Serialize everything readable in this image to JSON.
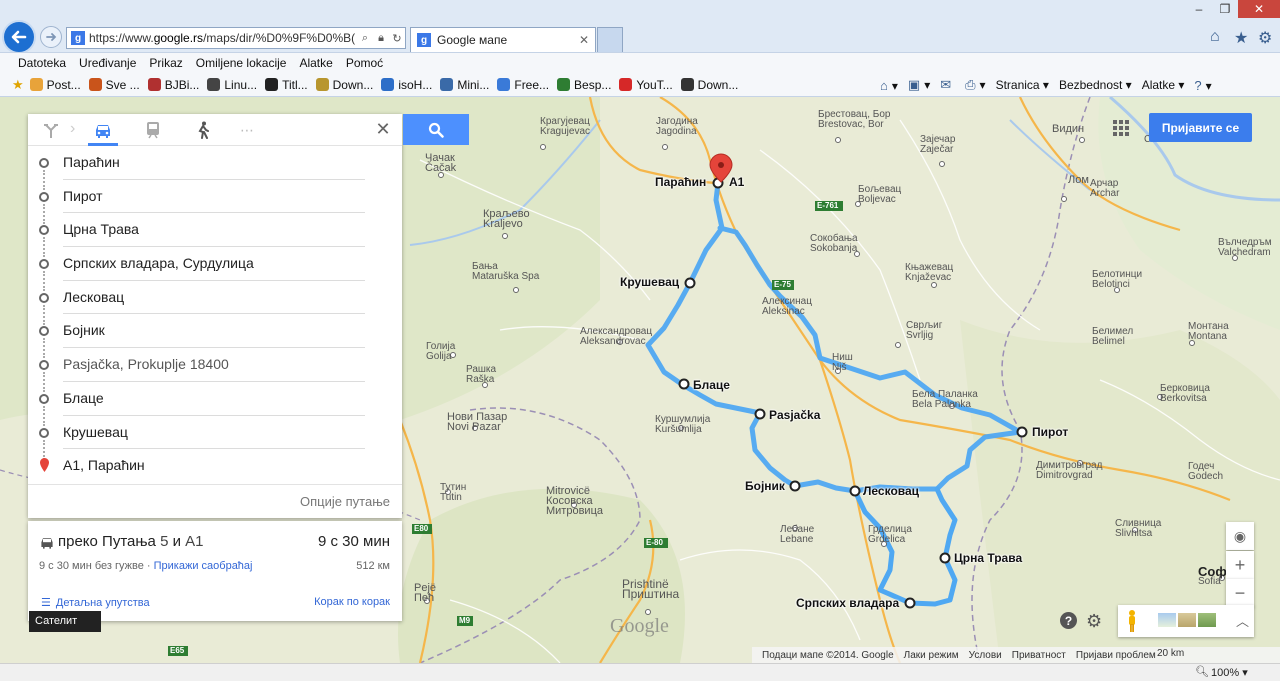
{
  "browser": {
    "url_prefix": "https://www.",
    "url_domain": "google.rs",
    "url_path": "/maps/dir/%D0%9F%D0%B(",
    "tab_title": "Google мапе",
    "menu": [
      "Datoteka",
      "Uređivanje",
      "Prikaz",
      "Omiljene lokacije",
      "Alatke",
      "Pomoć"
    ],
    "favorites": [
      {
        "label": "Post...",
        "color": "#e8a33a"
      },
      {
        "label": "Sve ...",
        "color": "#c9541b"
      },
      {
        "label": "BJBi...",
        "color": "#b03030"
      },
      {
        "label": "Linu...",
        "color": "#444444"
      },
      {
        "label": "Titl...",
        "color": "#222222"
      },
      {
        "label": "Down...",
        "color": "#b8962e"
      },
      {
        "label": "isoH...",
        "color": "#2d6ec8"
      },
      {
        "label": "Mini...",
        "color": "#3a6aa8"
      },
      {
        "label": "Free...",
        "color": "#3a7ad8"
      },
      {
        "label": "Besp...",
        "color": "#2e7d32"
      },
      {
        "label": "YouT...",
        "color": "#d62828"
      },
      {
        "label": "Down...",
        "color": "#333333"
      }
    ],
    "commands": [
      "Stranica",
      "Bezbednost",
      "Alatke"
    ],
    "zoom": "100%"
  },
  "directions": {
    "waypoints": [
      "Параћин",
      "Пирот",
      "Црна Трава",
      "Српских владара, Сурдулица",
      "Лесковац",
      "Бојник",
      "Pasjačka, Prokuplje 18400",
      "Блаце",
      "Крушевац",
      "A1, Параћин"
    ],
    "route_options": "Опције путање",
    "summary": {
      "via_prefix": "преко Путања",
      "via_num": "5",
      "via_conj": "и",
      "via_road": "A1",
      "time": "9 с 30 мин",
      "traffic_note": "9 с 30 мин без гужве",
      "separator": "·",
      "traffic_link": "Прикажи саобраћај",
      "distance": "512 км",
      "details": "Детаљна упутства",
      "steps": "Корак по корак"
    },
    "satellite": "Сателит"
  },
  "map": {
    "signin": "Пријавите се",
    "google_logo": "Google",
    "footer": [
      "Подаци мапе ©2014. Google",
      "Лаки режим",
      "Услови",
      "Приватност",
      "Пријави проблем"
    ],
    "scale": "20 km",
    "route_color": "#4fa8f2",
    "waypoint_labels": {
      "parachin": "Параћин",
      "a1": "A1",
      "krushevac": "Крушевац",
      "blace": "Блаце",
      "pasjacka": "Pasjačka",
      "bojnik": "Бојник",
      "leskovac": "Лесковац",
      "pirot": "Пирот",
      "crna_trava": "Црна Трава",
      "srpskih": "Српских владара"
    },
    "cities": {
      "kragujevac": "Крагујевац",
      "kragujevac_lat": "Kragujevac",
      "jagodina": "Јагодина",
      "jagodina_lat": "Jagodina",
      "brestovac": "Брестовац, Бор",
      "brestovac_lat": "Brestovac, Bor",
      "zajecar": "Зајечар",
      "zajecar_lat": "Zaječar",
      "vidin": "Видин",
      "calafat": "Calafat",
      "cacak": "Чачак",
      "cacak_lat": "Čačak",
      "boljevac": "Бољевац",
      "boljevac_lat": "Boljevac",
      "lom": "Лом",
      "archar": "Арчар",
      "archar_lat": "Archar",
      "kraljevo": "Краљево",
      "kraljevo_lat": "Kraljevo",
      "sokobanja": "Сокобања",
      "sokobanja_lat": "Sokobanja",
      "knjazevac": "Књажевац",
      "knjazevac_lat": "Knjaževac",
      "belotinci": "Белотинци",
      "belotinci_lat": "Belotinci",
      "vashovskiy": "Вълчедръм",
      "vashovskiy_lat": "Valchedram",
      "banja": "Бања",
      "banja_lat": "Mataruška Spa",
      "aleksinac": "Алексинац",
      "aleksinac_lat": "Aleksinac",
      "svrljig": "Сврљиг",
      "svrljig_lat": "Svrljig",
      "belimel": "Белимел",
      "belimel_lat": "Belimel",
      "montana": "Монтана",
      "montana_lat": "Montana",
      "aleksandrovac": "Александровац",
      "aleksandrovac_lat": "Aleksandrovac",
      "golija": "Голија",
      "golija_lat": "Golija",
      "nis": "Ниш",
      "nis_lat": "Niš",
      "raska": "Рашка",
      "raska_lat": "Raška",
      "bela_palanka": "Бела Паланка",
      "bela_palanka_lat": "Bela Palanka",
      "berkovitsa": "Берковица",
      "berkovitsa_lat": "Berkovitsa",
      "novi_pazar": "Нови Пазар",
      "novi_pazar_lat": "Novi Pazar",
      "kursumlija": "Куршумлија",
      "kursumlija_lat": "Kuršumlija",
      "dimitrovgrad": "Димитровград",
      "dimitrovgrad_lat": "Dimitrovgrad",
      "godech": "Годеч",
      "godech_lat": "Godech",
      "tutin": "Тутин",
      "tutin_lat": "Tutin",
      "mitrovica": "Mitrovicë",
      "mitrovica_cyr": "Косовска",
      "mitrovica_cyr2": "Митровица",
      "lebane": "Лебане",
      "lebane_lat": "Lebane",
      "grdelica": "Грделица",
      "grdelica_lat": "Grdelica",
      "slivnitsa": "Сливница",
      "slivnitsa_lat": "Slivnitsa",
      "sofia": "Софи",
      "sofia_lat": "Sofia",
      "peje": "Pejë",
      "pec": "Пећ",
      "pristina": "Prishtinë",
      "pristina_cyr": "Приштина"
    },
    "roads": {
      "e761": "E-761",
      "e75": "E-75",
      "e80": "E80",
      "e80b": "E-80",
      "m9": "M9",
      "e65": "E65"
    }
  }
}
